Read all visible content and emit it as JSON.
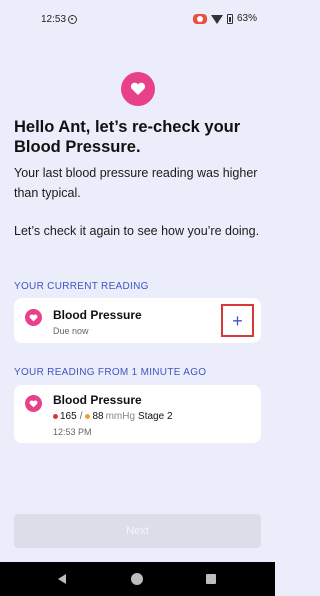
{
  "status_bar": {
    "time": "12:53",
    "battery": "63%"
  },
  "header": {
    "title": "Hello Ant, let’s re-check your Blood Pressure.",
    "intro_1": "Your last blood pressure reading was higher than typical.",
    "intro_2": "Let’s check it again to see how you’re doing."
  },
  "current_reading": {
    "section_label": "YOUR CURRENT READING",
    "title": "Blood Pressure",
    "subtitle": "Due now",
    "add_icon": "+"
  },
  "recent_reading": {
    "section_label": "YOUR READING FROM 1 MINUTE AGO",
    "title": "Blood Pressure",
    "systolic": "165",
    "separator": "/",
    "diastolic": "88",
    "unit": "mmHg",
    "stage": "Stage 2",
    "time": "12:53 PM"
  },
  "footer": {
    "next_label": "Next"
  },
  "colors": {
    "accent": "#3e56c4",
    "heart": "#e8418a",
    "highlight": "#d9383b"
  }
}
